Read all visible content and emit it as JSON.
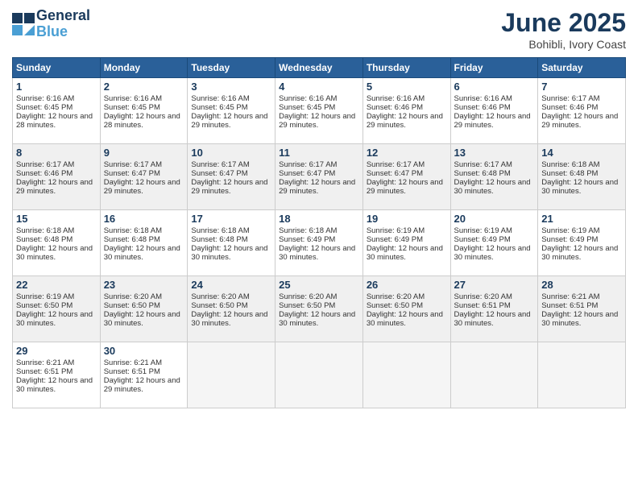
{
  "logo": {
    "line1": "General",
    "line2": "Blue"
  },
  "title": "June 2025",
  "location": "Bohibli, Ivory Coast",
  "days_header": [
    "Sunday",
    "Monday",
    "Tuesday",
    "Wednesday",
    "Thursday",
    "Friday",
    "Saturday"
  ],
  "weeks": [
    [
      {
        "day": "1",
        "sunrise": "Sunrise: 6:16 AM",
        "sunset": "Sunset: 6:45 PM",
        "daylight": "Daylight: 12 hours and 28 minutes."
      },
      {
        "day": "2",
        "sunrise": "Sunrise: 6:16 AM",
        "sunset": "Sunset: 6:45 PM",
        "daylight": "Daylight: 12 hours and 28 minutes."
      },
      {
        "day": "3",
        "sunrise": "Sunrise: 6:16 AM",
        "sunset": "Sunset: 6:45 PM",
        "daylight": "Daylight: 12 hours and 29 minutes."
      },
      {
        "day": "4",
        "sunrise": "Sunrise: 6:16 AM",
        "sunset": "Sunset: 6:45 PM",
        "daylight": "Daylight: 12 hours and 29 minutes."
      },
      {
        "day": "5",
        "sunrise": "Sunrise: 6:16 AM",
        "sunset": "Sunset: 6:46 PM",
        "daylight": "Daylight: 12 hours and 29 minutes."
      },
      {
        "day": "6",
        "sunrise": "Sunrise: 6:16 AM",
        "sunset": "Sunset: 6:46 PM",
        "daylight": "Daylight: 12 hours and 29 minutes."
      },
      {
        "day": "7",
        "sunrise": "Sunrise: 6:17 AM",
        "sunset": "Sunset: 6:46 PM",
        "daylight": "Daylight: 12 hours and 29 minutes."
      }
    ],
    [
      {
        "day": "8",
        "sunrise": "Sunrise: 6:17 AM",
        "sunset": "Sunset: 6:46 PM",
        "daylight": "Daylight: 12 hours and 29 minutes."
      },
      {
        "day": "9",
        "sunrise": "Sunrise: 6:17 AM",
        "sunset": "Sunset: 6:47 PM",
        "daylight": "Daylight: 12 hours and 29 minutes."
      },
      {
        "day": "10",
        "sunrise": "Sunrise: 6:17 AM",
        "sunset": "Sunset: 6:47 PM",
        "daylight": "Daylight: 12 hours and 29 minutes."
      },
      {
        "day": "11",
        "sunrise": "Sunrise: 6:17 AM",
        "sunset": "Sunset: 6:47 PM",
        "daylight": "Daylight: 12 hours and 29 minutes."
      },
      {
        "day": "12",
        "sunrise": "Sunrise: 6:17 AM",
        "sunset": "Sunset: 6:47 PM",
        "daylight": "Daylight: 12 hours and 29 minutes."
      },
      {
        "day": "13",
        "sunrise": "Sunrise: 6:17 AM",
        "sunset": "Sunset: 6:48 PM",
        "daylight": "Daylight: 12 hours and 30 minutes."
      },
      {
        "day": "14",
        "sunrise": "Sunrise: 6:18 AM",
        "sunset": "Sunset: 6:48 PM",
        "daylight": "Daylight: 12 hours and 30 minutes."
      }
    ],
    [
      {
        "day": "15",
        "sunrise": "Sunrise: 6:18 AM",
        "sunset": "Sunset: 6:48 PM",
        "daylight": "Daylight: 12 hours and 30 minutes."
      },
      {
        "day": "16",
        "sunrise": "Sunrise: 6:18 AM",
        "sunset": "Sunset: 6:48 PM",
        "daylight": "Daylight: 12 hours and 30 minutes."
      },
      {
        "day": "17",
        "sunrise": "Sunrise: 6:18 AM",
        "sunset": "Sunset: 6:48 PM",
        "daylight": "Daylight: 12 hours and 30 minutes."
      },
      {
        "day": "18",
        "sunrise": "Sunrise: 6:18 AM",
        "sunset": "Sunset: 6:49 PM",
        "daylight": "Daylight: 12 hours and 30 minutes."
      },
      {
        "day": "19",
        "sunrise": "Sunrise: 6:19 AM",
        "sunset": "Sunset: 6:49 PM",
        "daylight": "Daylight: 12 hours and 30 minutes."
      },
      {
        "day": "20",
        "sunrise": "Sunrise: 6:19 AM",
        "sunset": "Sunset: 6:49 PM",
        "daylight": "Daylight: 12 hours and 30 minutes."
      },
      {
        "day": "21",
        "sunrise": "Sunrise: 6:19 AM",
        "sunset": "Sunset: 6:49 PM",
        "daylight": "Daylight: 12 hours and 30 minutes."
      }
    ],
    [
      {
        "day": "22",
        "sunrise": "Sunrise: 6:19 AM",
        "sunset": "Sunset: 6:50 PM",
        "daylight": "Daylight: 12 hours and 30 minutes."
      },
      {
        "day": "23",
        "sunrise": "Sunrise: 6:20 AM",
        "sunset": "Sunset: 6:50 PM",
        "daylight": "Daylight: 12 hours and 30 minutes."
      },
      {
        "day": "24",
        "sunrise": "Sunrise: 6:20 AM",
        "sunset": "Sunset: 6:50 PM",
        "daylight": "Daylight: 12 hours and 30 minutes."
      },
      {
        "day": "25",
        "sunrise": "Sunrise: 6:20 AM",
        "sunset": "Sunset: 6:50 PM",
        "daylight": "Daylight: 12 hours and 30 minutes."
      },
      {
        "day": "26",
        "sunrise": "Sunrise: 6:20 AM",
        "sunset": "Sunset: 6:50 PM",
        "daylight": "Daylight: 12 hours and 30 minutes."
      },
      {
        "day": "27",
        "sunrise": "Sunrise: 6:20 AM",
        "sunset": "Sunset: 6:51 PM",
        "daylight": "Daylight: 12 hours and 30 minutes."
      },
      {
        "day": "28",
        "sunrise": "Sunrise: 6:21 AM",
        "sunset": "Sunset: 6:51 PM",
        "daylight": "Daylight: 12 hours and 30 minutes."
      }
    ],
    [
      {
        "day": "29",
        "sunrise": "Sunrise: 6:21 AM",
        "sunset": "Sunset: 6:51 PM",
        "daylight": "Daylight: 12 hours and 30 minutes."
      },
      {
        "day": "30",
        "sunrise": "Sunrise: 6:21 AM",
        "sunset": "Sunset: 6:51 PM",
        "daylight": "Daylight: 12 hours and 29 minutes."
      },
      null,
      null,
      null,
      null,
      null
    ]
  ]
}
